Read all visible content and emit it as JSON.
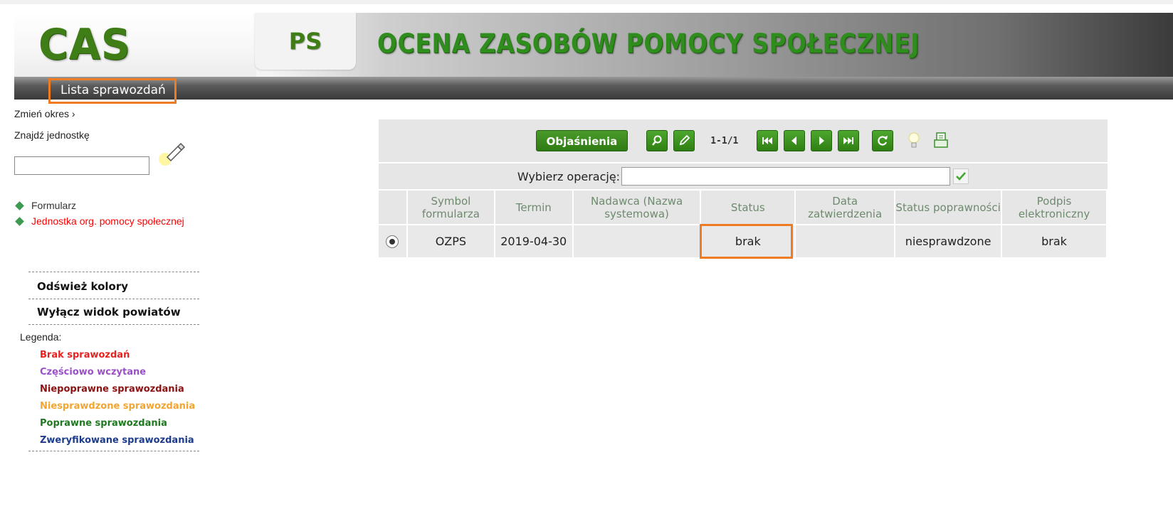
{
  "header": {
    "logo": "CAS",
    "module": "PS",
    "title": "OCENA ZASOBÓW POMOCY SPOŁECZNEJ"
  },
  "nav": {
    "active_item": "Lista sprawozdań"
  },
  "sidebar": {
    "change_period": "Zmień okres ›",
    "find_unit": "Znajdź jednostkę",
    "search_value": "",
    "tree": [
      {
        "label": "Formularz"
      },
      {
        "label": "Jednostka org. pomocy społecznej"
      }
    ],
    "refresh_colors": "Odśwież kolory",
    "toggle_districts": "Wyłącz widok powiatów",
    "legend_title": "Legenda:",
    "legend": [
      {
        "label": "Brak sprawozdań",
        "color": "#e8201e"
      },
      {
        "label": "Częściowo wczytane",
        "color": "#9b4fc9"
      },
      {
        "label": "Niepoprawne sprawozdania",
        "color": "#8a1212"
      },
      {
        "label": "Niesprawdzone sprawozdania",
        "color": "#f2a531"
      },
      {
        "label": "Poprawne sprawozdania",
        "color": "#1e7a1e"
      },
      {
        "label": "Zweryfikowane sprawozdania",
        "color": "#1e3c8c"
      }
    ]
  },
  "toolbar": {
    "explanations": "Objaśnienia",
    "pager": "1-1/1",
    "icons": [
      "search-icon",
      "edit-icon",
      "first-page-icon",
      "prev-page-icon",
      "next-page-icon",
      "last-page-icon",
      "refresh-icon",
      "bulb-icon",
      "print-icon"
    ]
  },
  "operation": {
    "label": "Wybierz operację:",
    "value": ""
  },
  "table": {
    "columns": [
      "",
      "Symbol formularza",
      "Termin",
      "Nadawca (Nazwa systemowa)",
      "Status",
      "Data zatwierdzenia",
      "Status poprawności",
      "Podpis elektroniczny"
    ],
    "rows": [
      {
        "selected": true,
        "symbol": "OZPS",
        "termin": "2019-04-30",
        "nadawca": "",
        "status": "brak",
        "data_zatw": "",
        "status_popr": "niesprawdzone",
        "podpis": "brak"
      }
    ]
  }
}
